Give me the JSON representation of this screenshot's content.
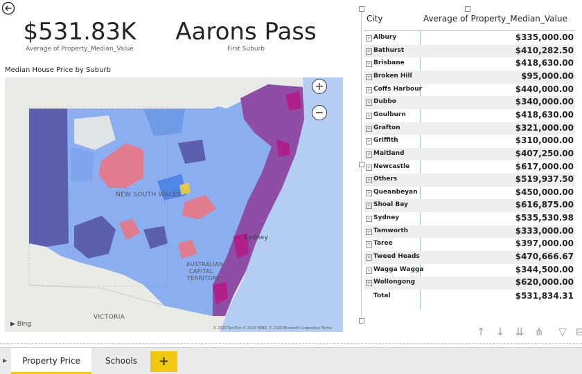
{
  "cards": {
    "avg_value": "$531.83K",
    "avg_caption": "Average of Property_Median_Value",
    "first_suburb": "Aarons Pass",
    "first_caption": "First Suburb"
  },
  "map": {
    "title": "Median House Price by Suburb",
    "zoom_in": "+",
    "zoom_out": "−",
    "state_label": "NEW SOUTH WALES",
    "city_label": "Sydney",
    "territory_label_1": "AUSTRALIAN",
    "territory_label_2": "CAPITAL",
    "territory_label_3": "TERRITORY",
    "victoria_label": "VICTORIA",
    "bing_label": "Bing",
    "copyright": "© 2020 TomTom © 2020 HERE, © 2020 Microsoft Corporation Terms",
    "colors": {
      "ocean": "#b4cdf2",
      "land": "#e8ebe6",
      "blue": "#8aaef0",
      "navy": "#5a5fb0",
      "purple": "#8e4ea6",
      "pink": "#e07c8e",
      "magenta": "#b0208a"
    }
  },
  "table": {
    "col_city": "City",
    "col_value": "Average of Property_Median_Value",
    "rows": [
      {
        "city": "Albury",
        "value": "$335,000.00"
      },
      {
        "city": "Bathurst",
        "value": "$410,282.50"
      },
      {
        "city": "Brisbane",
        "value": "$418,630.00"
      },
      {
        "city": "Broken Hill",
        "value": "$95,000.00"
      },
      {
        "city": "Coffs Harbour",
        "value": "$440,000.00"
      },
      {
        "city": "Dubbo",
        "value": "$340,000.00"
      },
      {
        "city": "Goulburn",
        "value": "$418,630.00"
      },
      {
        "city": "Grafton",
        "value": "$321,000.00"
      },
      {
        "city": "Griffith",
        "value": "$310,000.00"
      },
      {
        "city": "Maitland",
        "value": "$407,250.00"
      },
      {
        "city": "Newcastle",
        "value": "$617,000.00"
      },
      {
        "city": "Others",
        "value": "$519,937.50"
      },
      {
        "city": "Queanbeyan",
        "value": "$450,000.00"
      },
      {
        "city": "Shoal Bay",
        "value": "$616,875.00"
      },
      {
        "city": "Sydney",
        "value": "$535,530.98"
      },
      {
        "city": "Tamworth",
        "value": "$333,000.00"
      },
      {
        "city": "Taree",
        "value": "$397,000.00"
      },
      {
        "city": "Tweed Heads",
        "value": "$470,666.67"
      },
      {
        "city": "Wagga Wagga",
        "value": "$344,500.00"
      },
      {
        "city": "Wollongong",
        "value": "$620,000.00"
      }
    ],
    "total_label": "Total",
    "total_value": "$531,834.31"
  },
  "tabs": [
    {
      "label": "Property Price",
      "active": true
    },
    {
      "label": "Schools",
      "active": false
    }
  ],
  "add_tab": "+",
  "accent": "#f2c811"
}
